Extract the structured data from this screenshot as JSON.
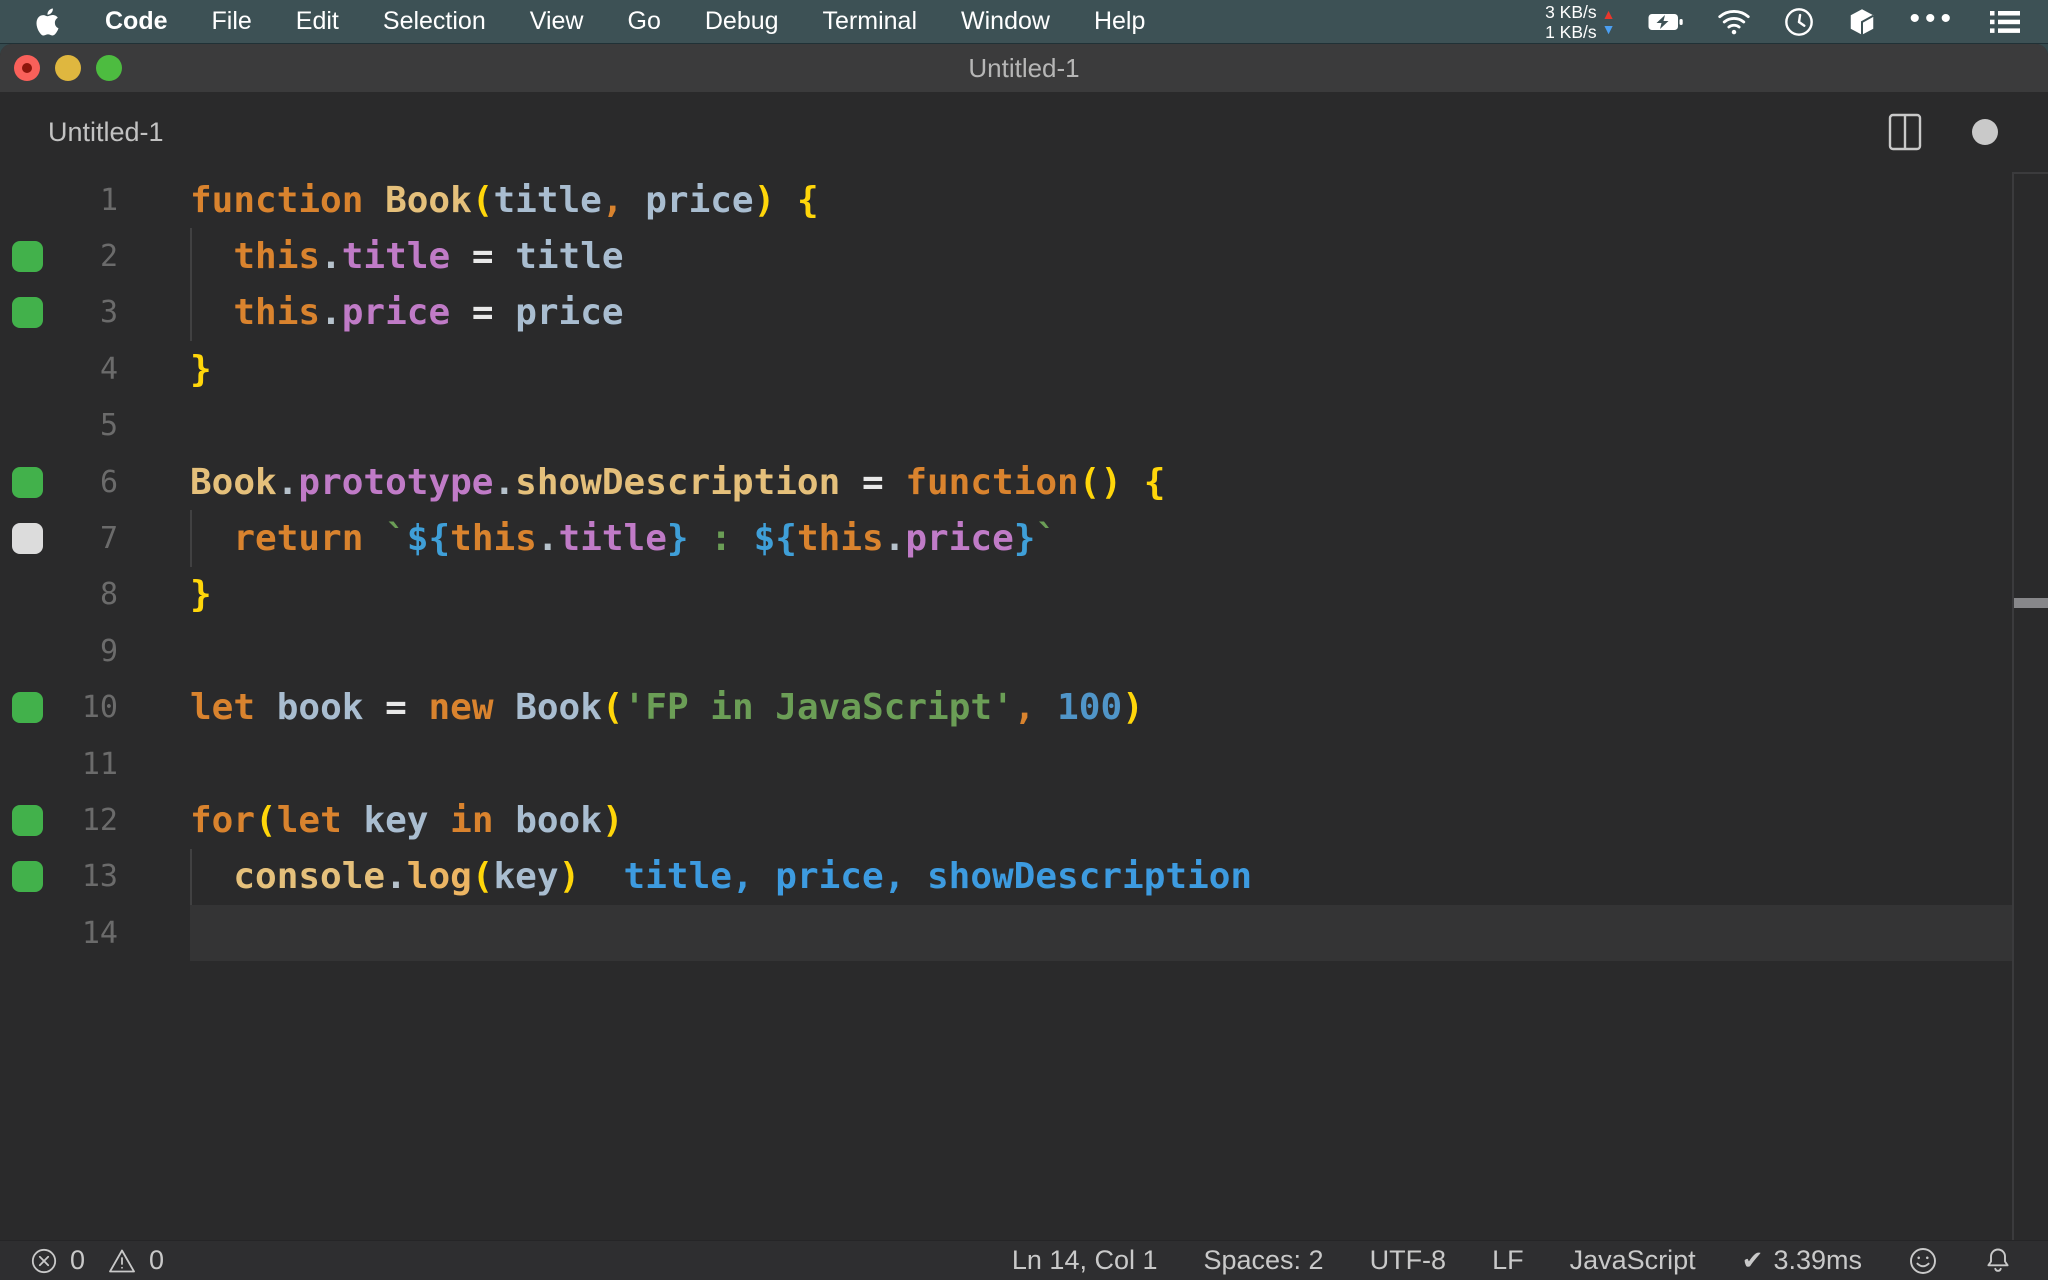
{
  "menubar": {
    "apple_menu_icon": "apple-logo",
    "items": [
      "Code",
      "File",
      "Edit",
      "Selection",
      "View",
      "Go",
      "Debug",
      "Terminal",
      "Window",
      "Help"
    ],
    "network_up": "3 KB/s",
    "network_down": "1 KB/s",
    "up_arrow": "▲",
    "down_arrow": "▼",
    "ellipsis": "•••",
    "right_icons": [
      "network-throughput",
      "battery-charging-icon",
      "wifi-icon",
      "clock-icon",
      "cube-icon",
      "ellipsis-icon",
      "list-menu-icon"
    ]
  },
  "window": {
    "title": "Untitled-1",
    "tab_title": "Untitled-1",
    "tab_icons": [
      "split-editor-icon",
      "unsaved-dot"
    ],
    "modified": true
  },
  "editor": {
    "language": "javascript",
    "total_lines": 14,
    "marker_colors": {
      "green": "#42b14b",
      "gray": "#dcdcdc"
    },
    "syntax_colors": {
      "kw": "#d9832e",
      "fn": "#e5c07b",
      "fn2": "#ecb563",
      "yb": "#ffd60a",
      "vr": "#a9bdd0",
      "pp": "#c07bc7",
      "op": "#e8e8e8",
      "cm": "#d9832e",
      "st": "#6b9e56",
      "tp": "#3f9fd8",
      "nm": "#5095c8",
      "dt": "#b6c2cc",
      "pl": "#d4d4d4",
      "ev": "#3d9be0"
    },
    "lines": [
      {
        "num": 1,
        "marker": null,
        "guide": false,
        "current": false,
        "tokens": [
          [
            "kw",
            "function"
          ],
          [
            "pl",
            " "
          ],
          [
            "fn",
            "Book"
          ],
          [
            "yb",
            "("
          ],
          [
            "vr",
            "title"
          ],
          [
            "cm",
            ","
          ],
          [
            "pl",
            " "
          ],
          [
            "vr",
            "price"
          ],
          [
            "yb",
            ")"
          ],
          [
            "pl",
            " "
          ],
          [
            "yb",
            "{"
          ]
        ]
      },
      {
        "num": 2,
        "marker": "green",
        "guide": true,
        "current": false,
        "tokens": [
          [
            "pl",
            "  "
          ],
          [
            "kw",
            "this"
          ],
          [
            "dt",
            "."
          ],
          [
            "pp",
            "title"
          ],
          [
            "pl",
            " "
          ],
          [
            "op",
            "="
          ],
          [
            "pl",
            " "
          ],
          [
            "vr",
            "title"
          ]
        ]
      },
      {
        "num": 3,
        "marker": "green",
        "guide": true,
        "current": false,
        "tokens": [
          [
            "pl",
            "  "
          ],
          [
            "kw",
            "this"
          ],
          [
            "dt",
            "."
          ],
          [
            "pp",
            "price"
          ],
          [
            "pl",
            " "
          ],
          [
            "op",
            "="
          ],
          [
            "pl",
            " "
          ],
          [
            "vr",
            "price"
          ]
        ]
      },
      {
        "num": 4,
        "marker": null,
        "guide": false,
        "current": false,
        "tokens": [
          [
            "yb",
            "}"
          ]
        ]
      },
      {
        "num": 5,
        "marker": null,
        "guide": false,
        "current": false,
        "tokens": []
      },
      {
        "num": 6,
        "marker": "green",
        "guide": false,
        "current": false,
        "tokens": [
          [
            "fn",
            "Book"
          ],
          [
            "dt",
            "."
          ],
          [
            "pp",
            "prototype"
          ],
          [
            "dt",
            "."
          ],
          [
            "fn",
            "showDescription"
          ],
          [
            "pl",
            " "
          ],
          [
            "op",
            "="
          ],
          [
            "pl",
            " "
          ],
          [
            "kw",
            "function"
          ],
          [
            "yb",
            "()"
          ],
          [
            "pl",
            " "
          ],
          [
            "yb",
            "{"
          ]
        ]
      },
      {
        "num": 7,
        "marker": "gray",
        "guide": true,
        "current": false,
        "tokens": [
          [
            "pl",
            "  "
          ],
          [
            "kw",
            "return"
          ],
          [
            "pl",
            " "
          ],
          [
            "st",
            "`"
          ],
          [
            "tp",
            "${"
          ],
          [
            "kw",
            "this"
          ],
          [
            "dt",
            "."
          ],
          [
            "pp",
            "title"
          ],
          [
            "tp",
            "}"
          ],
          [
            "st",
            " : "
          ],
          [
            "tp",
            "${"
          ],
          [
            "kw",
            "this"
          ],
          [
            "dt",
            "."
          ],
          [
            "pp",
            "price"
          ],
          [
            "tp",
            "}"
          ],
          [
            "st",
            "`"
          ]
        ]
      },
      {
        "num": 8,
        "marker": null,
        "guide": false,
        "current": false,
        "tokens": [
          [
            "yb",
            "}"
          ]
        ]
      },
      {
        "num": 9,
        "marker": null,
        "guide": false,
        "current": false,
        "tokens": []
      },
      {
        "num": 10,
        "marker": "green",
        "guide": false,
        "current": false,
        "tokens": [
          [
            "kw",
            "let"
          ],
          [
            "pl",
            " "
          ],
          [
            "vr",
            "book"
          ],
          [
            "pl",
            " "
          ],
          [
            "op",
            "="
          ],
          [
            "pl",
            " "
          ],
          [
            "kw",
            "new"
          ],
          [
            "pl",
            " "
          ],
          [
            "vr",
            "Book"
          ],
          [
            "yb",
            "("
          ],
          [
            "st",
            "'FP in JavaScript'"
          ],
          [
            "cm",
            ","
          ],
          [
            "pl",
            " "
          ],
          [
            "nm",
            "100"
          ],
          [
            "yb",
            ")"
          ]
        ]
      },
      {
        "num": 11,
        "marker": null,
        "guide": false,
        "current": false,
        "tokens": []
      },
      {
        "num": 12,
        "marker": "green",
        "guide": false,
        "current": false,
        "tokens": [
          [
            "kw",
            "for"
          ],
          [
            "yb",
            "("
          ],
          [
            "kw",
            "let"
          ],
          [
            "pl",
            " "
          ],
          [
            "vr",
            "key"
          ],
          [
            "pl",
            " "
          ],
          [
            "kw",
            "in"
          ],
          [
            "pl",
            " "
          ],
          [
            "vr",
            "book"
          ],
          [
            "yb",
            ")"
          ]
        ]
      },
      {
        "num": 13,
        "marker": "green",
        "guide": true,
        "current": false,
        "tokens": [
          [
            "pl",
            "  "
          ],
          [
            "fn",
            "console"
          ],
          [
            "dt",
            "."
          ],
          [
            "fn2",
            "log"
          ],
          [
            "yb",
            "("
          ],
          [
            "vr",
            "key"
          ],
          [
            "yb",
            ")"
          ],
          [
            "ev",
            "  title, price, showDescription"
          ]
        ]
      },
      {
        "num": 14,
        "marker": null,
        "guide": false,
        "current": true,
        "tokens": []
      }
    ]
  },
  "statusbar": {
    "errors": "0",
    "warnings": "0",
    "cursor": "Ln 14, Col 1",
    "indent": "Spaces: 2",
    "encoding": "UTF-8",
    "eol": "LF",
    "language": "JavaScript",
    "check": "✔",
    "time": "3.39ms",
    "icons": [
      "error-circle-icon",
      "warning-triangle-icon",
      "check-icon",
      "smiley-icon",
      "bell-icon"
    ]
  }
}
